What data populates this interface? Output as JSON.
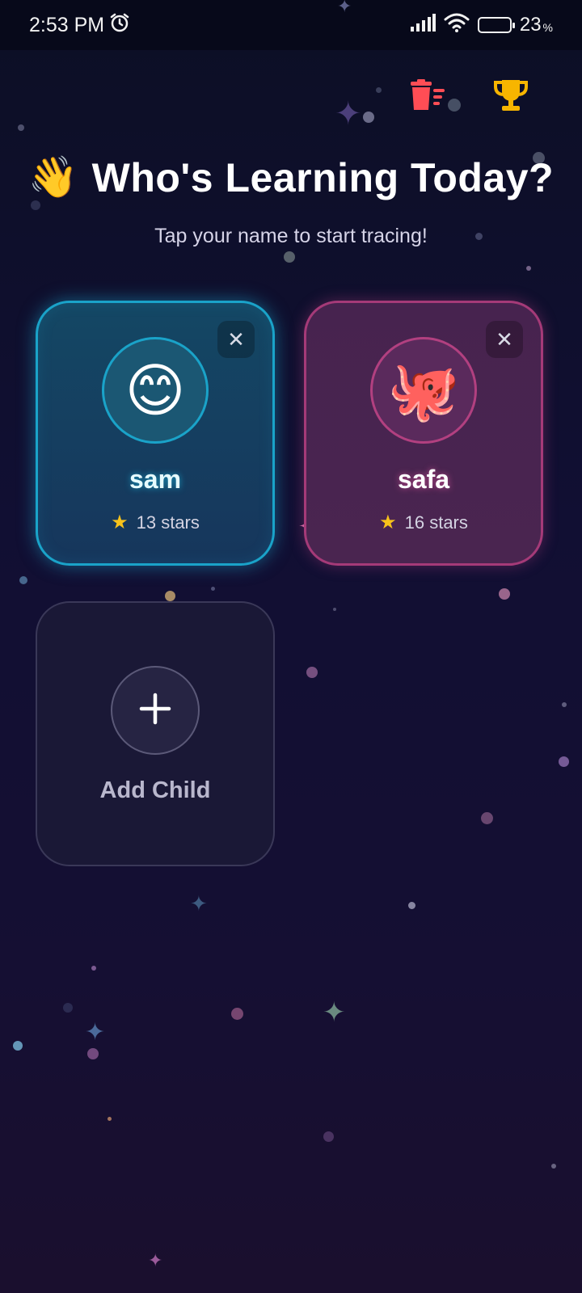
{
  "status_bar": {
    "time": "2:53 PM",
    "battery_percent": "23",
    "battery_suffix": "%",
    "battery_level": 0.23,
    "icons": [
      "alarm-icon",
      "signal-icon",
      "wifi-icon",
      "battery-icon"
    ]
  },
  "header": {
    "icons": [
      "delete-all-icon",
      "trophy-icon"
    ],
    "colors": {
      "delete": "#ff4d55",
      "trophy": "#f7b500"
    }
  },
  "title": {
    "emoji": "👋",
    "text": "Who's Learning Today?"
  },
  "subtitle": "Tap your name to start tracing!",
  "profiles": [
    {
      "name": "sam",
      "avatar": "😊",
      "stars_text": "13 stars",
      "accent": "#1aa3c9"
    },
    {
      "name": "safa",
      "avatar": "🐙",
      "stars_text": "16 stars",
      "accent": "#b24080"
    }
  ],
  "add_child": {
    "label": "Add Child",
    "icon": "plus-icon"
  },
  "colors": {
    "background_top": "#0c0f25",
    "background_bottom": "#1a0f2e",
    "star": "#f7c21b"
  }
}
